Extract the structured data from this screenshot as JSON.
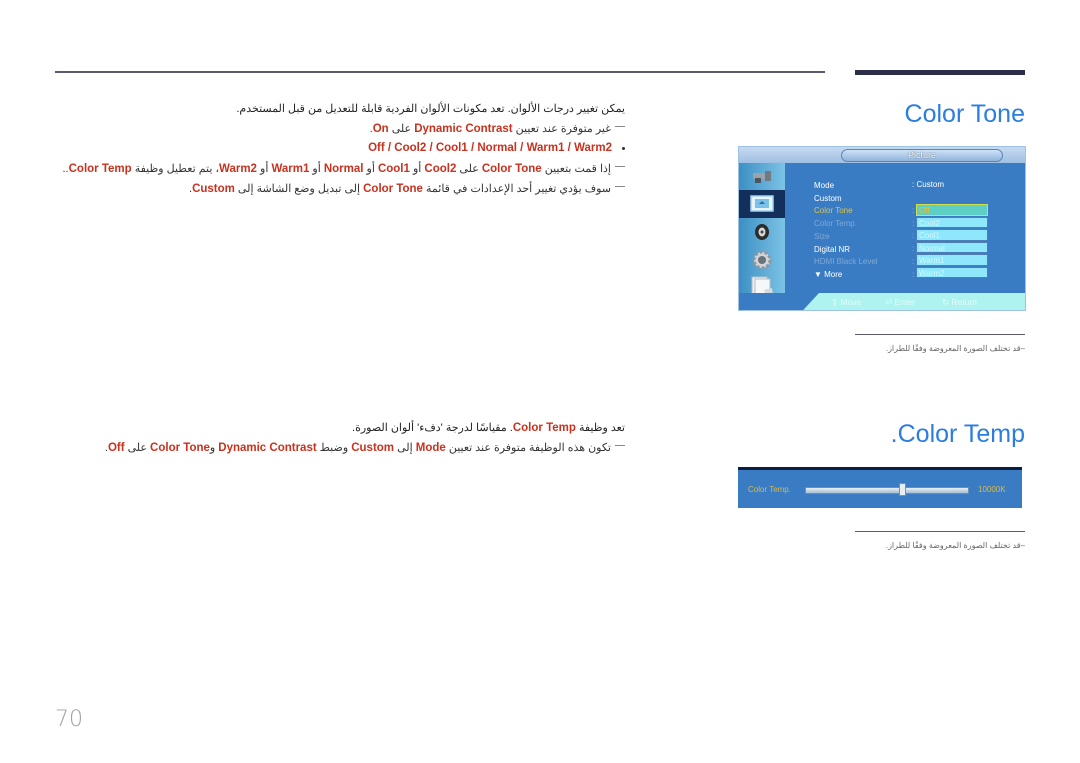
{
  "page_number": "70",
  "sections": {
    "color_tone": {
      "title": "Color Tone",
      "description": "يمكن تغيير درجات الألوان. تعد مكونات الألوان الفردية قابلة للتعديل من قبل المستخدم.",
      "note1": {
        "pre": "غير متوفرة عند تعيين ",
        "kw1": "Dynamic Contrast",
        "mid": " على ",
        "kw2": "On",
        "post": "."
      },
      "options_line": "Off / Cool2 / Cool1 / Normal / Warm1 / Warm2",
      "note2": {
        "p1": "إذا قمت بتعيين ",
        "kw1": "Color Tone",
        "p2": " على ",
        "kw2": "Cool2",
        "p3": " أو ",
        "kw3": "Cool1",
        "p4": " أو ",
        "kw4": "Normal",
        "p5": " أو ",
        "kw5": "Warm1",
        "p6": " أو ",
        "kw6": "Warm2",
        "p7": "، يتم تعطيل وظيفة ",
        "kw7": "Color Temp",
        "p8": ".."
      },
      "note3": {
        "p1": "سوف يؤدي تغيير أحد الإعدادات في قائمة ",
        "kw1": "Color Tone",
        "p2": " إلى تبديل وضع الشاشة إلى ",
        "kw2": "Custom",
        "p3": "."
      },
      "caption": "قد تختلف الصورة المعروضة وفقًا للطراز."
    },
    "color_temp": {
      "title": ".Color Temp",
      "description": {
        "p1": "تعد وظيفة ",
        "kw1": "Color Temp",
        "p2": ". مقياسًا لدرجة 'دفء' ألوان الصورة."
      },
      "note1": {
        "p1": "تكون هذه الوظيفة متوفرة عند تعيين ",
        "kw1": "Mode",
        "p2": " إلى ",
        "kw2": "Custom",
        "p3": " وضبط ",
        "kw3": "Dynamic Contrast",
        "p4": " و",
        "kw4": "Color Tone",
        "p5": " على ",
        "kw5": "Off",
        "p6": "."
      },
      "caption": "قد تختلف الصورة المعروضة وفقًا للطراز."
    }
  },
  "osd_menu": {
    "title": "Picture",
    "side_icons": [
      "input-icon",
      "picture-icon",
      "sound-icon",
      "setup-icon",
      "support-icon"
    ],
    "selected_side_index": 1,
    "rows": [
      {
        "label": "Mode",
        "state": "normal"
      },
      {
        "label": "Custom",
        "state": "normal"
      },
      {
        "label": "Color Tone",
        "state": "selected"
      },
      {
        "label": "Color Temp.",
        "state": "disabled"
      },
      {
        "label": "Size",
        "state": "disabled"
      },
      {
        "label": "Digital NR",
        "state": "normal"
      },
      {
        "label": "HDMI Black Level",
        "state": "disabled"
      },
      {
        "label": "▼ More",
        "state": "normal"
      }
    ],
    "mode_value": ": Custom",
    "dropdown_options": [
      "Off",
      "Cool2",
      "Cool1",
      "Normal",
      "Warm1",
      "Warm2"
    ],
    "dropdown_selected": "Off",
    "nav": {
      "move": "Move",
      "enter": "Enter",
      "return": "Return"
    }
  },
  "color_temp_slider": {
    "label": "Color Temp.",
    "value_text": "10000K",
    "position_fraction": 0.6
  },
  "colors": {
    "accent_title": "#2b7de0",
    "keyword": "#c8321e",
    "osd_blue": "#3a7cc4"
  }
}
